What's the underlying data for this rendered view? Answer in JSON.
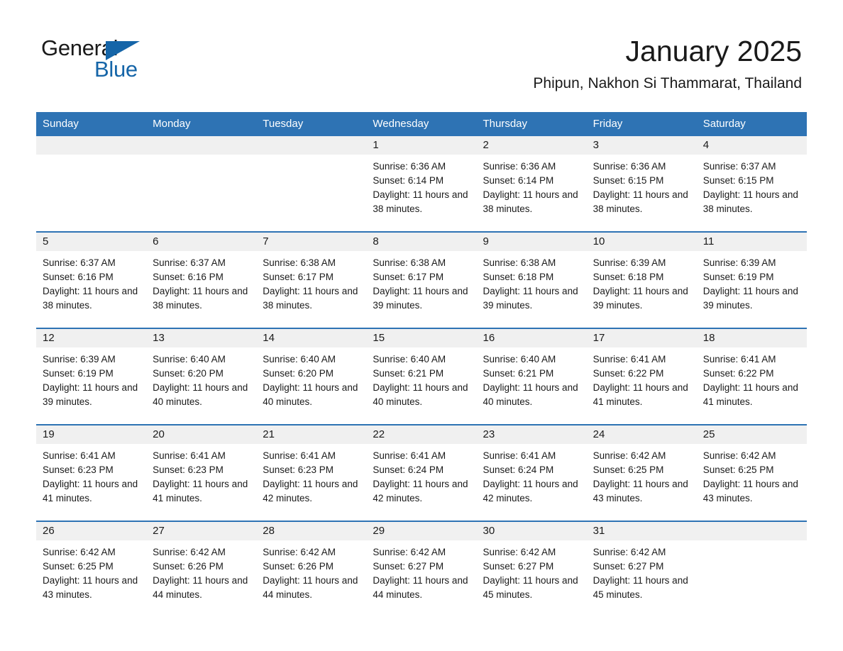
{
  "logo": {
    "word1": "General",
    "word2": "Blue",
    "accent_color": "#1565a8",
    "triangle_icon": "triangle-icon"
  },
  "header": {
    "title": "January 2025",
    "location": "Phipun, Nakhon Si Thammarat, Thailand"
  },
  "theme": {
    "header_blue": "#2e73b4",
    "row_divider_blue": "#2e73b4",
    "daynum_gray": "#f0f0f0"
  },
  "calendar": {
    "weekday_headers": [
      "Sunday",
      "Monday",
      "Tuesday",
      "Wednesday",
      "Thursday",
      "Friday",
      "Saturday"
    ],
    "weeks": [
      [
        {
          "day": "",
          "sunrise": "",
          "sunset": "",
          "daylight": ""
        },
        {
          "day": "",
          "sunrise": "",
          "sunset": "",
          "daylight": ""
        },
        {
          "day": "",
          "sunrise": "",
          "sunset": "",
          "daylight": ""
        },
        {
          "day": "1",
          "sunrise": "Sunrise: 6:36 AM",
          "sunset": "Sunset: 6:14 PM",
          "daylight": "Daylight: 11 hours and 38 minutes."
        },
        {
          "day": "2",
          "sunrise": "Sunrise: 6:36 AM",
          "sunset": "Sunset: 6:14 PM",
          "daylight": "Daylight: 11 hours and 38 minutes."
        },
        {
          "day": "3",
          "sunrise": "Sunrise: 6:36 AM",
          "sunset": "Sunset: 6:15 PM",
          "daylight": "Daylight: 11 hours and 38 minutes."
        },
        {
          "day": "4",
          "sunrise": "Sunrise: 6:37 AM",
          "sunset": "Sunset: 6:15 PM",
          "daylight": "Daylight: 11 hours and 38 minutes."
        }
      ],
      [
        {
          "day": "5",
          "sunrise": "Sunrise: 6:37 AM",
          "sunset": "Sunset: 6:16 PM",
          "daylight": "Daylight: 11 hours and 38 minutes."
        },
        {
          "day": "6",
          "sunrise": "Sunrise: 6:37 AM",
          "sunset": "Sunset: 6:16 PM",
          "daylight": "Daylight: 11 hours and 38 minutes."
        },
        {
          "day": "7",
          "sunrise": "Sunrise: 6:38 AM",
          "sunset": "Sunset: 6:17 PM",
          "daylight": "Daylight: 11 hours and 38 minutes."
        },
        {
          "day": "8",
          "sunrise": "Sunrise: 6:38 AM",
          "sunset": "Sunset: 6:17 PM",
          "daylight": "Daylight: 11 hours and 39 minutes."
        },
        {
          "day": "9",
          "sunrise": "Sunrise: 6:38 AM",
          "sunset": "Sunset: 6:18 PM",
          "daylight": "Daylight: 11 hours and 39 minutes."
        },
        {
          "day": "10",
          "sunrise": "Sunrise: 6:39 AM",
          "sunset": "Sunset: 6:18 PM",
          "daylight": "Daylight: 11 hours and 39 minutes."
        },
        {
          "day": "11",
          "sunrise": "Sunrise: 6:39 AM",
          "sunset": "Sunset: 6:19 PM",
          "daylight": "Daylight: 11 hours and 39 minutes."
        }
      ],
      [
        {
          "day": "12",
          "sunrise": "Sunrise: 6:39 AM",
          "sunset": "Sunset: 6:19 PM",
          "daylight": "Daylight: 11 hours and 39 minutes."
        },
        {
          "day": "13",
          "sunrise": "Sunrise: 6:40 AM",
          "sunset": "Sunset: 6:20 PM",
          "daylight": "Daylight: 11 hours and 40 minutes."
        },
        {
          "day": "14",
          "sunrise": "Sunrise: 6:40 AM",
          "sunset": "Sunset: 6:20 PM",
          "daylight": "Daylight: 11 hours and 40 minutes."
        },
        {
          "day": "15",
          "sunrise": "Sunrise: 6:40 AM",
          "sunset": "Sunset: 6:21 PM",
          "daylight": "Daylight: 11 hours and 40 minutes."
        },
        {
          "day": "16",
          "sunrise": "Sunrise: 6:40 AM",
          "sunset": "Sunset: 6:21 PM",
          "daylight": "Daylight: 11 hours and 40 minutes."
        },
        {
          "day": "17",
          "sunrise": "Sunrise: 6:41 AM",
          "sunset": "Sunset: 6:22 PM",
          "daylight": "Daylight: 11 hours and 41 minutes."
        },
        {
          "day": "18",
          "sunrise": "Sunrise: 6:41 AM",
          "sunset": "Sunset: 6:22 PM",
          "daylight": "Daylight: 11 hours and 41 minutes."
        }
      ],
      [
        {
          "day": "19",
          "sunrise": "Sunrise: 6:41 AM",
          "sunset": "Sunset: 6:23 PM",
          "daylight": "Daylight: 11 hours and 41 minutes."
        },
        {
          "day": "20",
          "sunrise": "Sunrise: 6:41 AM",
          "sunset": "Sunset: 6:23 PM",
          "daylight": "Daylight: 11 hours and 41 minutes."
        },
        {
          "day": "21",
          "sunrise": "Sunrise: 6:41 AM",
          "sunset": "Sunset: 6:23 PM",
          "daylight": "Daylight: 11 hours and 42 minutes."
        },
        {
          "day": "22",
          "sunrise": "Sunrise: 6:41 AM",
          "sunset": "Sunset: 6:24 PM",
          "daylight": "Daylight: 11 hours and 42 minutes."
        },
        {
          "day": "23",
          "sunrise": "Sunrise: 6:41 AM",
          "sunset": "Sunset: 6:24 PM",
          "daylight": "Daylight: 11 hours and 42 minutes."
        },
        {
          "day": "24",
          "sunrise": "Sunrise: 6:42 AM",
          "sunset": "Sunset: 6:25 PM",
          "daylight": "Daylight: 11 hours and 43 minutes."
        },
        {
          "day": "25",
          "sunrise": "Sunrise: 6:42 AM",
          "sunset": "Sunset: 6:25 PM",
          "daylight": "Daylight: 11 hours and 43 minutes."
        }
      ],
      [
        {
          "day": "26",
          "sunrise": "Sunrise: 6:42 AM",
          "sunset": "Sunset: 6:25 PM",
          "daylight": "Daylight: 11 hours and 43 minutes."
        },
        {
          "day": "27",
          "sunrise": "Sunrise: 6:42 AM",
          "sunset": "Sunset: 6:26 PM",
          "daylight": "Daylight: 11 hours and 44 minutes."
        },
        {
          "day": "28",
          "sunrise": "Sunrise: 6:42 AM",
          "sunset": "Sunset: 6:26 PM",
          "daylight": "Daylight: 11 hours and 44 minutes."
        },
        {
          "day": "29",
          "sunrise": "Sunrise: 6:42 AM",
          "sunset": "Sunset: 6:27 PM",
          "daylight": "Daylight: 11 hours and 44 minutes."
        },
        {
          "day": "30",
          "sunrise": "Sunrise: 6:42 AM",
          "sunset": "Sunset: 6:27 PM",
          "daylight": "Daylight: 11 hours and 45 minutes."
        },
        {
          "day": "31",
          "sunrise": "Sunrise: 6:42 AM",
          "sunset": "Sunset: 6:27 PM",
          "daylight": "Daylight: 11 hours and 45 minutes."
        },
        {
          "day": "",
          "sunrise": "",
          "sunset": "",
          "daylight": ""
        }
      ]
    ]
  }
}
